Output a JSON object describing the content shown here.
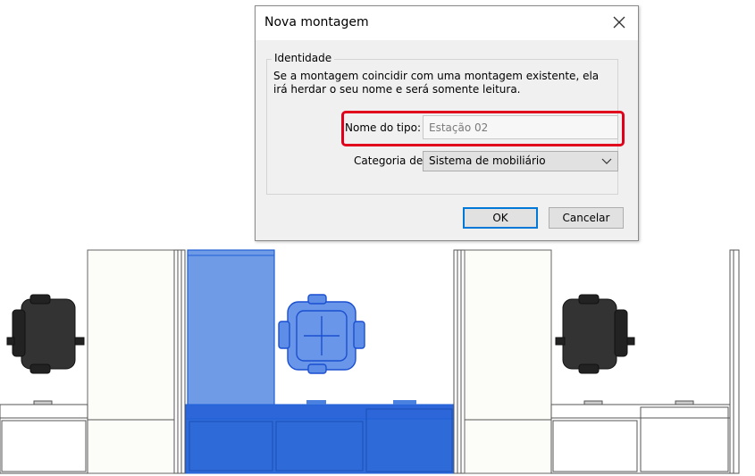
{
  "dialog": {
    "title": "Nova montagem",
    "group_label": "Identidade",
    "description_line1": "Se a montagem coincidir com uma montagem existente, ela",
    "description_line2": "irá herdar o seu nome e será somente leitura.",
    "type_name_label": "Nome do tipo:",
    "type_name_value": "Estação 02",
    "category_label": "Categoria de",
    "category_value": "Sistema de mobiliário",
    "ok_label": "OK",
    "cancel_label": "Cancelar"
  },
  "icons": {
    "close": "close-icon",
    "dropdown": "chevron-down-icon"
  },
  "colors": {
    "highlight_border": "#e0001b",
    "selection_blue": "#1f5fd6",
    "selection_fill": "#2c66d9",
    "default_button_border": "#0078d7",
    "chair_dark": "#333333"
  }
}
